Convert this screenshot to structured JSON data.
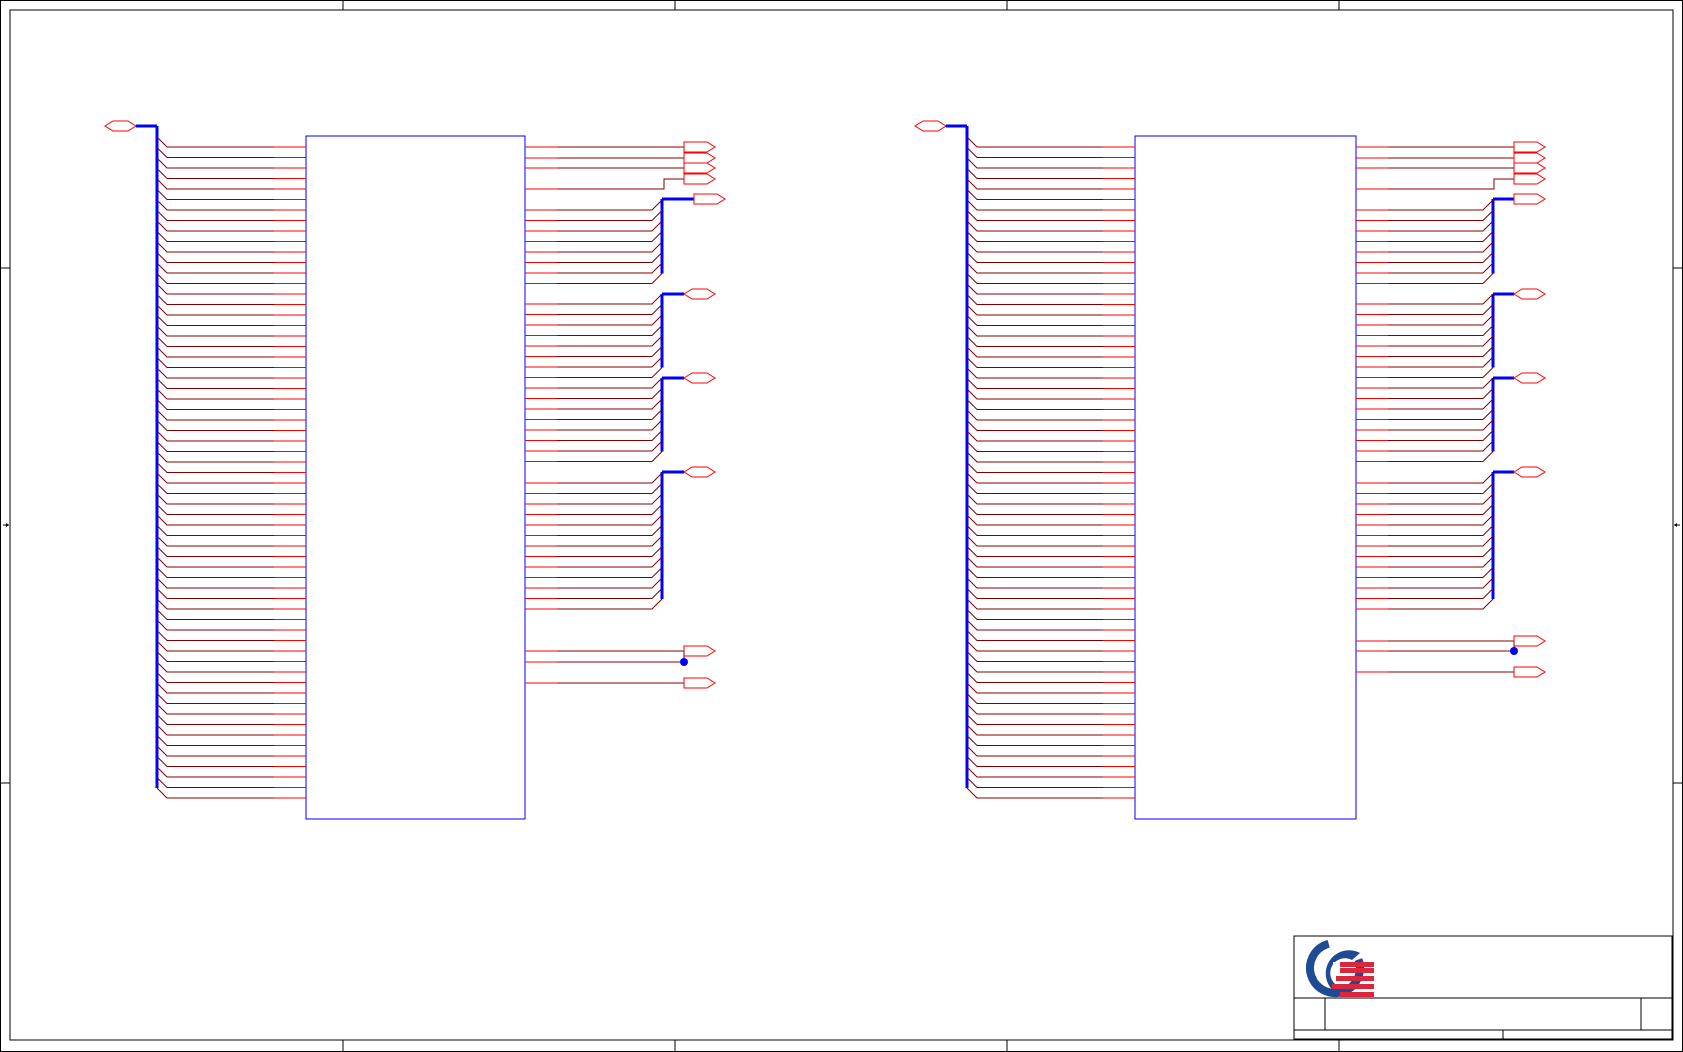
{
  "viewer": {
    "name": "schematic-sheet-viewer"
  },
  "colors": {
    "border": "#000000",
    "bus": "#0000ff",
    "net_wire": "#800000",
    "pin_stub": "#ff0000",
    "component_outline": "#0000ff",
    "port": "#ff0000",
    "junction": "#0000ff",
    "logo_blue": "#1f4a96",
    "logo_red": "#d9283b"
  },
  "symbols": [
    {
      "name": "memory-chip-left",
      "left_pin_count": 63,
      "right_groups": [
        1,
        8,
        8,
        8,
        13
      ],
      "single_outputs": 4,
      "bottom_outputs": 3
    },
    {
      "name": "memory-chip-right",
      "left_pin_count": 63,
      "right_groups": [
        1,
        8,
        8,
        8,
        13
      ],
      "single_outputs": 4,
      "bottom_outputs": 2
    }
  ],
  "title_block": {
    "logo": "quanta-logo",
    "title": "",
    "sheet": ""
  }
}
